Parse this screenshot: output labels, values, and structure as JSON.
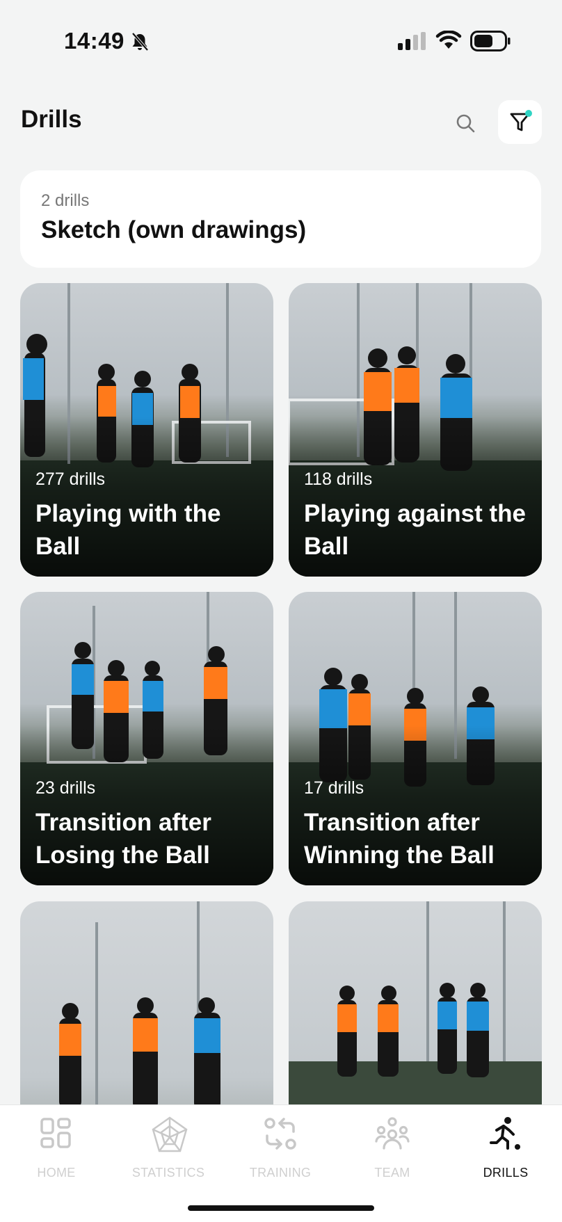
{
  "status_bar": {
    "time": "14:49",
    "icons": [
      "bell-slash-icon",
      "cellular-signal-icon",
      "wifi-icon",
      "battery-icon"
    ]
  },
  "header": {
    "title": "Drills",
    "search_icon": "search-icon",
    "filter_icon": "filter-icon",
    "filter_active_color": "#2fd4c4"
  },
  "sketch_card": {
    "count": "2 drills",
    "title": "Sketch (own drawings)"
  },
  "categories": [
    {
      "count": "277 drills",
      "name": "Playing with the Ball",
      "bib_colors": [
        "#ff7a1a",
        "#1f8fd6"
      ]
    },
    {
      "count": "118 drills",
      "name": "Playing against the Ball",
      "bib_colors": [
        "#ff7a1a",
        "#1f8fd6"
      ]
    },
    {
      "count": "23 drills",
      "name": "Transition after Losing the Ball",
      "bib_colors": [
        "#ff7a1a",
        "#1f8fd6"
      ]
    },
    {
      "count": "17 drills",
      "name": "Transition after Winning the Ball",
      "bib_colors": [
        "#ff7a1a",
        "#1f8fd6"
      ]
    },
    {
      "count": "",
      "name": "",
      "bib_colors": [
        "#ff7a1a",
        "#1f8fd6"
      ]
    },
    {
      "count": "",
      "name": "",
      "bib_colors": [
        "#ff7a1a",
        "#1f8fd6"
      ]
    }
  ],
  "tab_bar": {
    "tabs": [
      {
        "label": "HOME",
        "icon": "home-grid-icon",
        "active": false
      },
      {
        "label": "STATISTICS",
        "icon": "statistics-web-icon",
        "active": false
      },
      {
        "label": "TRAINING",
        "icon": "training-arrows-icon",
        "active": false
      },
      {
        "label": "TEAM",
        "icon": "team-icon",
        "active": false
      },
      {
        "label": "DRILLS",
        "icon": "drills-runner-icon",
        "active": true
      }
    ]
  }
}
